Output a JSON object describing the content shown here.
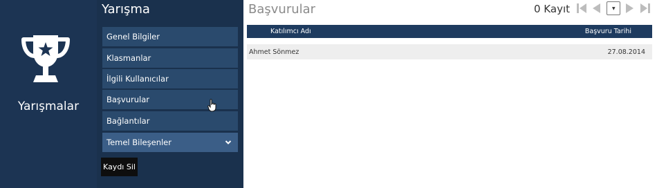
{
  "sidebar": {
    "app_title": "Yarışmalar"
  },
  "menu": {
    "title": "Yarışma",
    "items": [
      {
        "label": "Genel Bilgiler"
      },
      {
        "label": "Klasmanlar"
      },
      {
        "label": "İlgili Kullanıcılar"
      },
      {
        "label": "Başvurular"
      },
      {
        "label": "Bağlantılar"
      },
      {
        "label": "Temel Bileşenler"
      }
    ],
    "delete_label": "Kaydı Sil"
  },
  "content": {
    "title": "Başvurular",
    "record_count": "0 Kayıt",
    "table": {
      "columns": [
        "Katılımcı Adı",
        "Başvuru Tarihi"
      ],
      "rows": [
        [
          "Ahmet Sönmez",
          "27.08.2014"
        ]
      ]
    }
  },
  "icons": {
    "app": "trophy-icon",
    "menu_expand": "chevron-down-icon",
    "pager": [
      "first-page-icon",
      "previous-page-icon",
      "page-select-icon",
      "next-page-icon",
      "last-page-icon"
    ]
  },
  "colors": {
    "left_panel": "#1c3453",
    "menu_panel": "#1a314d",
    "menu_item": "#2a4a6d",
    "menu_item_active": "#3b5e87",
    "table_header": "#1e3b5f",
    "row_bg": "#eeeeee",
    "pager_icon": "#bdbdbd"
  }
}
